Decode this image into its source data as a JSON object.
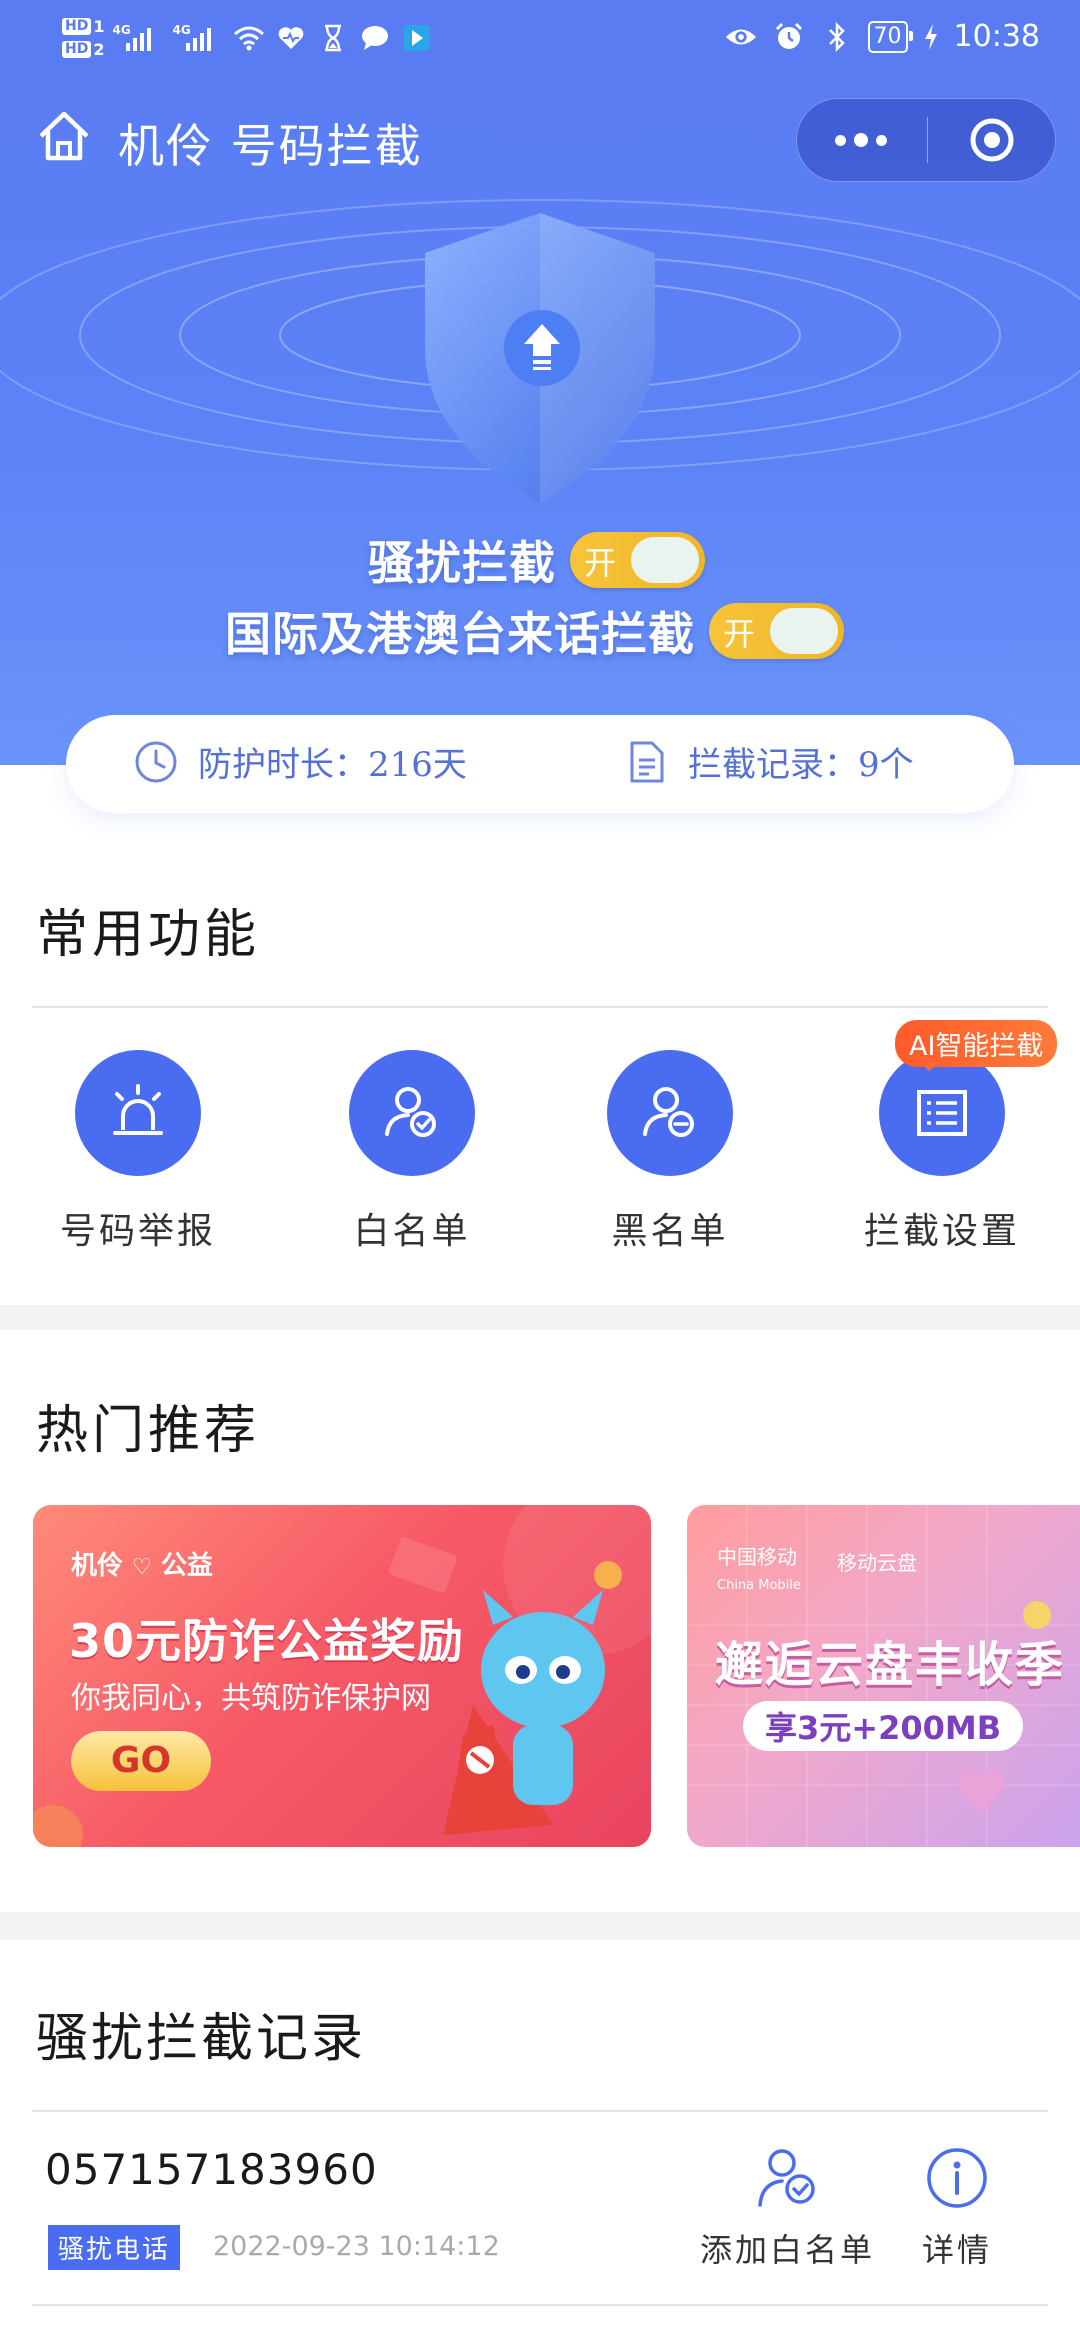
{
  "status_bar": {
    "hd1": "HD",
    "hd1_num": "1",
    "hd2": "HD",
    "hd2_num": "2",
    "net1": "4G",
    "net2": "4G",
    "battery": "70",
    "time": "10:38",
    "icons": [
      "wifi-icon",
      "heart-icon",
      "hourglass-icon",
      "chat-icon",
      "app-icon",
      "eye-icon",
      "alarm-icon",
      "bluetooth-icon",
      "charging-icon"
    ]
  },
  "header": {
    "title": "机伶 号码拦截",
    "home_icon": "home-icon",
    "more_icon": "more-dots-icon",
    "close_icon": "target-icon"
  },
  "hero": {
    "toggles": [
      {
        "label": "骚扰拦截",
        "state": "开"
      },
      {
        "label": "国际及港澳台来话拦截",
        "state": "开"
      }
    ]
  },
  "stats": {
    "protect_label": "防护时长：216天",
    "intercept_label": "拦截记录：9个"
  },
  "common_functions": {
    "title": "常用功能",
    "items": [
      {
        "label": "号码举报",
        "icon": "alarm-light-icon"
      },
      {
        "label": "白名单",
        "icon": "user-check-icon"
      },
      {
        "label": "黑名单",
        "icon": "user-minus-icon"
      },
      {
        "label": "拦截设置",
        "icon": "list-icon"
      }
    ],
    "ai_badge": "AI智能拦截"
  },
  "hot": {
    "title": "热门推荐",
    "banners": [
      {
        "brand": "机伶",
        "brand2": "公益",
        "headline": "30元防诈公益奖励",
        "sub": "你我同心，共筑防诈保护网",
        "cta": "GO"
      },
      {
        "brand": "中国移动",
        "brand_en": "China Mobile",
        "brand2": "移动云盘",
        "headline": "邂逅云盘丰收季",
        "sub": "享3元+200MB"
      }
    ]
  },
  "records": {
    "title": "骚扰拦截记录",
    "items": [
      {
        "phone": "057157183960",
        "tag": "骚扰电话",
        "time": "2022-09-23 10:14:12",
        "add_whitelist": "添加白名单",
        "details": "详情"
      }
    ]
  },
  "colors": {
    "primary": "#4a6cf0",
    "hero": "#5b82f6",
    "toggle": "#f3bb2e",
    "badge": "#ff6430"
  }
}
